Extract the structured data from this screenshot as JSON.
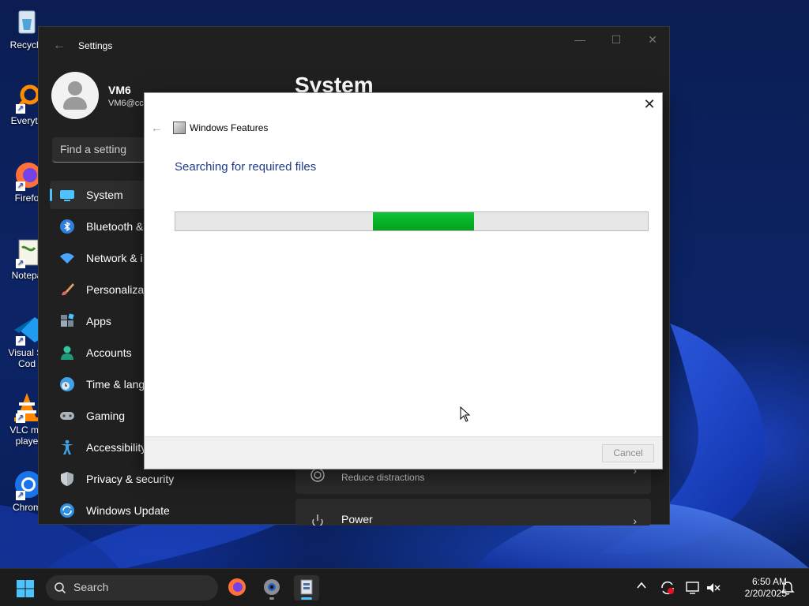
{
  "desktop": {
    "icons": [
      {
        "label": "Recycle",
        "icon": "recycle-bin-icon"
      },
      {
        "label": "Everyth",
        "icon": "everything-search-icon"
      },
      {
        "label": "Firefo",
        "icon": "firefox-icon"
      },
      {
        "label": "Notepa",
        "icon": "notepad-icon"
      },
      {
        "label": "Visual St\nCod",
        "icon": "vscode-icon"
      },
      {
        "label": "VLC me\nplaye",
        "icon": "vlc-icon"
      },
      {
        "label": "Chrom",
        "icon": "chrome-icon"
      }
    ]
  },
  "settings": {
    "window_title": "Settings",
    "profile": {
      "name": "VM6",
      "email": "VM6@cc"
    },
    "search_placeholder": "Find a setting",
    "page_title": "System",
    "nav": [
      {
        "label": "System",
        "icon": "system-icon",
        "active": true
      },
      {
        "label": "Bluetooth &",
        "icon": "bluetooth-icon"
      },
      {
        "label": "Network & i",
        "icon": "wifi-icon"
      },
      {
        "label": "Personalizat",
        "icon": "brush-icon"
      },
      {
        "label": "Apps",
        "icon": "apps-icon"
      },
      {
        "label": "Accounts",
        "icon": "accounts-icon"
      },
      {
        "label": "Time & lang",
        "icon": "clock-icon"
      },
      {
        "label": "Gaming",
        "icon": "gamepad-icon"
      },
      {
        "label": "Accessibility",
        "icon": "accessibility-icon"
      },
      {
        "label": "Privacy & security",
        "icon": "shield-icon"
      },
      {
        "label": "Windows Update",
        "icon": "update-icon"
      }
    ],
    "cards": [
      {
        "label": "",
        "sub": "Reduce distractions",
        "icon": "focus-icon"
      },
      {
        "label": "Power",
        "sub": "",
        "icon": "power-icon"
      }
    ]
  },
  "dialog": {
    "title": "Windows Features",
    "heading": "Searching for required files",
    "progress_indeterminate": true,
    "cancel_label": "Cancel",
    "close_glyph": "✕"
  },
  "taskbar": {
    "search_label": "Search",
    "time": "6:50 AM",
    "date": "2/20/2025"
  },
  "colors": {
    "accent": "#4cc2ff",
    "progress_green": "#06b025",
    "heading_blue": "#1e3a8a"
  }
}
